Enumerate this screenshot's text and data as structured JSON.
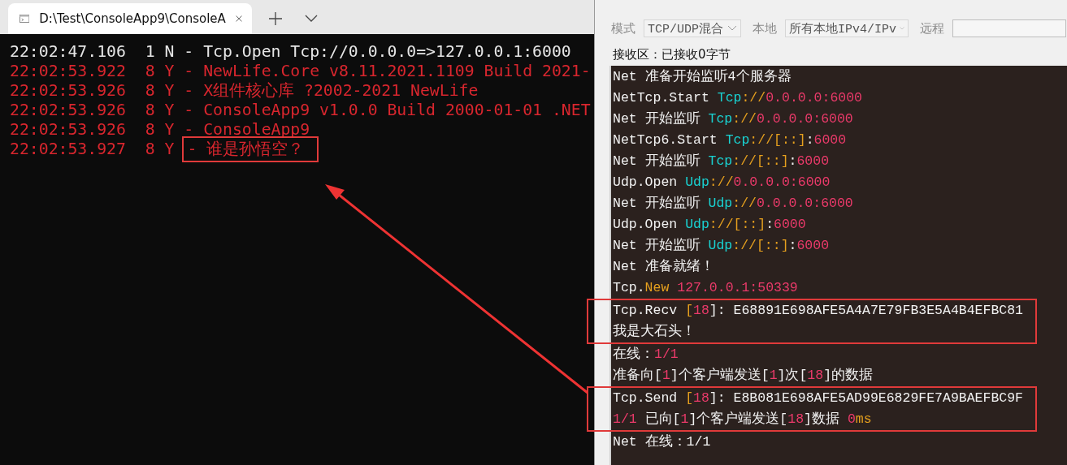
{
  "terminal": {
    "tab": {
      "title": "D:\\Test\\ConsoleApp9\\ConsoleA",
      "selected": true
    },
    "lines": [
      {
        "color": "#e6e6e6",
        "segments": [
          {
            "text": "22:02:47.106  1 N - Tcp.Open Tcp://0.0.0.0=>127.0.0.1:6000",
            "boxed": false
          }
        ]
      },
      {
        "color": "#d9262e",
        "segments": [
          {
            "text": "22:02:53.922  8 Y - NewLife.Core v8.11.2021.1109 Build 2021-",
            "boxed": false
          }
        ]
      },
      {
        "color": "#d9262e",
        "segments": [
          {
            "text": "22:02:53.926  8 Y - X组件核心库 ?2002-2021 NewLife",
            "boxed": false
          }
        ]
      },
      {
        "color": "#d9262e",
        "segments": [
          {
            "text": "22:02:53.926  8 Y - ConsoleApp9 v1.0.0 Build 2000-01-01 .NET",
            "boxed": false
          }
        ]
      },
      {
        "color": "#d9262e",
        "segments": [
          {
            "text": "22:02:53.926  8 Y - ConsoleApp9",
            "boxed": false
          }
        ]
      },
      {
        "color": "#d9262e",
        "segments": [
          {
            "text": "22:02:53.927  8 Y ",
            "boxed": false
          },
          {
            "text": "- 谁是孙悟空？",
            "boxed": true
          }
        ]
      }
    ]
  },
  "tool": {
    "fields": [
      {
        "kind": "select",
        "label": "模式",
        "value": "TCP/UDP混合"
      },
      {
        "kind": "select",
        "label": "本地",
        "value": "所有本地IPv4/IPv"
      },
      {
        "kind": "input",
        "label": "远程"
      }
    ],
    "receive_title": "接收区：已接收0字节",
    "log": [
      {
        "boxed": false,
        "segments": [
          {
            "text": "Net 准备开始监听4个服务器",
            "color": "#f2f2f2"
          }
        ]
      },
      {
        "boxed": false,
        "segments": [
          {
            "text": "NetTcp.Start ",
            "color": "#f2f2f2"
          },
          {
            "text": "Tcp",
            "color": "#19d3d3"
          },
          {
            "text": "://",
            "color": "#e6a01e"
          },
          {
            "text": "0.0.0.0:6000",
            "color": "#eb3a6a"
          }
        ]
      },
      {
        "boxed": false,
        "segments": [
          {
            "text": "Net 开始监听 ",
            "color": "#f2f2f2"
          },
          {
            "text": "Tcp",
            "color": "#19d3d3"
          },
          {
            "text": "://",
            "color": "#e6a01e"
          },
          {
            "text": "0.0.0.0:6000",
            "color": "#eb3a6a"
          }
        ]
      },
      {
        "boxed": false,
        "segments": [
          {
            "text": "NetTcp6.Start ",
            "color": "#f2f2f2"
          },
          {
            "text": "Tcp",
            "color": "#19d3d3"
          },
          {
            "text": "://[::]",
            "color": "#e6a01e"
          },
          {
            "text": ":",
            "color": "#f2f2f2"
          },
          {
            "text": "6000",
            "color": "#eb3a6a"
          }
        ]
      },
      {
        "boxed": false,
        "segments": [
          {
            "text": "Net 开始监听 ",
            "color": "#f2f2f2"
          },
          {
            "text": "Tcp",
            "color": "#19d3d3"
          },
          {
            "text": "://[::]",
            "color": "#e6a01e"
          },
          {
            "text": ":",
            "color": "#f2f2f2"
          },
          {
            "text": "6000",
            "color": "#eb3a6a"
          }
        ]
      },
      {
        "boxed": false,
        "segments": [
          {
            "text": "Udp.Open ",
            "color": "#f2f2f2"
          },
          {
            "text": "Udp",
            "color": "#19d3d3"
          },
          {
            "text": "://",
            "color": "#e6a01e"
          },
          {
            "text": "0.0.0.0:6000",
            "color": "#eb3a6a"
          }
        ]
      },
      {
        "boxed": false,
        "segments": [
          {
            "text": "Net 开始监听 ",
            "color": "#f2f2f2"
          },
          {
            "text": "Udp",
            "color": "#19d3d3"
          },
          {
            "text": "://",
            "color": "#e6a01e"
          },
          {
            "text": "0.0.0.0:6000",
            "color": "#eb3a6a"
          }
        ]
      },
      {
        "boxed": false,
        "segments": [
          {
            "text": "Udp.Open ",
            "color": "#f2f2f2"
          },
          {
            "text": "Udp",
            "color": "#19d3d3"
          },
          {
            "text": "://[::]",
            "color": "#e6a01e"
          },
          {
            "text": ":",
            "color": "#f2f2f2"
          },
          {
            "text": "6000",
            "color": "#eb3a6a"
          }
        ]
      },
      {
        "boxed": false,
        "segments": [
          {
            "text": "Net 开始监听 ",
            "color": "#f2f2f2"
          },
          {
            "text": "Udp",
            "color": "#19d3d3"
          },
          {
            "text": "://[::]",
            "color": "#e6a01e"
          },
          {
            "text": ":",
            "color": "#f2f2f2"
          },
          {
            "text": "6000",
            "color": "#eb3a6a"
          }
        ]
      },
      {
        "boxed": false,
        "segments": [
          {
            "text": "Net 准备就绪！",
            "color": "#f2f2f2"
          }
        ]
      },
      {
        "boxed": false,
        "segments": [
          {
            "text": "Tcp.",
            "color": "#f2f2f2"
          },
          {
            "text": "New",
            "color": "#e6a01e"
          },
          {
            "text": " 127.0.0.1:50339",
            "color": "#eb3a6a"
          }
        ]
      },
      {
        "boxed": true,
        "segments": [
          {
            "text": "Tcp.Recv ",
            "color": "#f2f2f2"
          },
          {
            "text": "[",
            "color": "#e6a01e"
          },
          {
            "text": "18",
            "color": "#eb3a6a"
          },
          {
            "text": "]: E68891E698AFE5A4A7E79FB3E5A4B4EFBC81",
            "color": "#f2f2f2"
          }
        ]
      },
      {
        "boxed": true,
        "segments": [
          {
            "text": "我是大石头！",
            "color": "#f2f2f2"
          }
        ]
      },
      {
        "boxed": false,
        "segments": [
          {
            "text": "在线：",
            "color": "#f2f2f2"
          },
          {
            "text": "1/1",
            "color": "#eb3a6a"
          }
        ]
      },
      {
        "boxed": false,
        "segments": [
          {
            "text": "准备向[",
            "color": "#f2f2f2"
          },
          {
            "text": "1",
            "color": "#eb3a6a"
          },
          {
            "text": "]个客户端发送[",
            "color": "#f2f2f2"
          },
          {
            "text": "1",
            "color": "#eb3a6a"
          },
          {
            "text": "]次[",
            "color": "#f2f2f2"
          },
          {
            "text": "18",
            "color": "#eb3a6a"
          },
          {
            "text": "]的数据",
            "color": "#f2f2f2"
          }
        ]
      },
      {
        "boxed": true,
        "segments": [
          {
            "text": "Tcp.Send ",
            "color": "#f2f2f2"
          },
          {
            "text": "[",
            "color": "#e6a01e"
          },
          {
            "text": "18",
            "color": "#eb3a6a"
          },
          {
            "text": "]: E8B081E698AFE5AD99E6829FE7A9BAEFBC9F",
            "color": "#f2f2f2"
          }
        ]
      },
      {
        "boxed": true,
        "segments": [
          {
            "text": "1/1",
            "color": "#eb3a6a"
          },
          {
            "text": " 已向[",
            "color": "#f2f2f2"
          },
          {
            "text": "1",
            "color": "#eb3a6a"
          },
          {
            "text": "]个客户端发送[",
            "color": "#f2f2f2"
          },
          {
            "text": "18",
            "color": "#eb3a6a"
          },
          {
            "text": "]数据 ",
            "color": "#f2f2f2"
          },
          {
            "text": "0",
            "color": "#eb3a6a"
          },
          {
            "text": "ms",
            "color": "#e6a01e"
          }
        ]
      },
      {
        "boxed": false,
        "segments": [
          {
            "text": "Net 在线：1/1",
            "color": "#f2f2f2"
          }
        ]
      }
    ]
  }
}
